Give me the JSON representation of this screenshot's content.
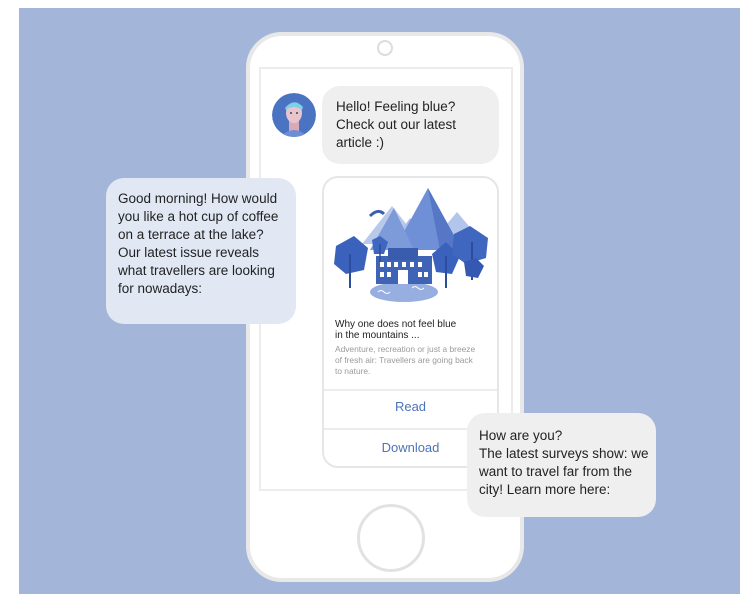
{
  "chat": {
    "bot_message_1": [
      "Hello! Feeling blue?",
      "Check out our latest",
      "article :)"
    ],
    "bot_message_2": [
      "Good morning! How would",
      "you like a hot cup of coffee",
      "on a terrace at the lake?",
      "Our latest issue reveals",
      "what travellers are looking",
      "for nowadays:"
    ],
    "bot_message_3": [
      "How are you?",
      "The latest surveys show: we",
      "want to travel far from the",
      "city! Learn more here:"
    ]
  },
  "article_card": {
    "title": [
      "Why one does not feel blue",
      "in the mountains ..."
    ],
    "description": [
      "Adventure, recreation or just a breeze",
      "of fresh air: Travellers are going back",
      "to nature."
    ],
    "read_label": "Read",
    "download_label": "Download"
  },
  "colors": {
    "background": "#a3b6da",
    "accent_blue": "#4d74b8",
    "bubble_gray": "#efefef",
    "bubble_blue": "#e1e8f4"
  },
  "icons": {
    "avatar": "bot-avatar-icon",
    "illustration": "mountain-lake-illustration"
  }
}
